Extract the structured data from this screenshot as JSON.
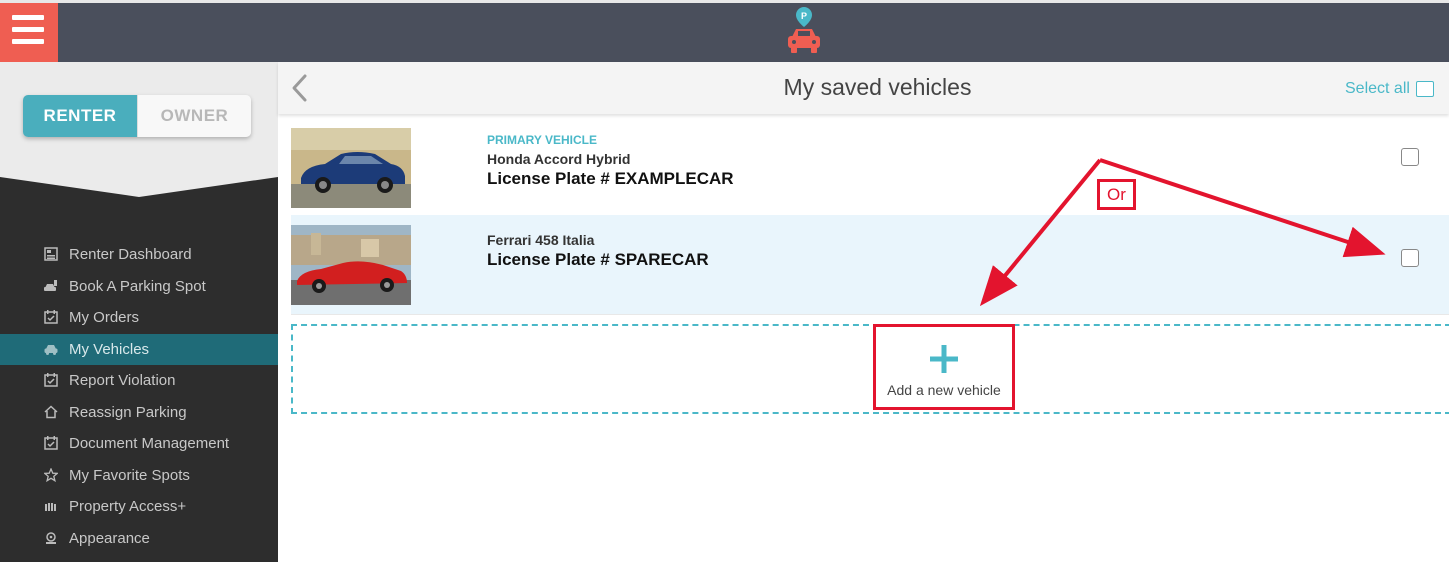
{
  "header": {
    "menu_icon": "hamburger-icon",
    "logo_icon": "parking-car-logo-icon"
  },
  "sidebar": {
    "toggle": {
      "renter": "RENTER",
      "owner": "OWNER",
      "selected": "RENTER"
    },
    "items": [
      {
        "label": "Renter Dashboard",
        "icon": "dashboard-icon"
      },
      {
        "label": "Book A Parking Spot",
        "icon": "car-book-icon"
      },
      {
        "label": "My Orders",
        "icon": "calendar-check-icon"
      },
      {
        "label": "My Vehicles",
        "icon": "car-icon",
        "active": true
      },
      {
        "label": "Report Violation",
        "icon": "calendar-check-icon"
      },
      {
        "label": "Reassign Parking",
        "icon": "home-icon"
      },
      {
        "label": "Document Management",
        "icon": "calendar-check-icon"
      },
      {
        "label": "My Favorite Spots",
        "icon": "star-icon"
      },
      {
        "label": "Property Access+",
        "icon": "gate-icon"
      },
      {
        "label": "Appearance",
        "icon": "palette-icon"
      }
    ]
  },
  "main": {
    "title": "My saved vehicles",
    "select_all_label": "Select all",
    "vehicles": [
      {
        "tag": "PRIMARY VEHICLE",
        "name": "Honda Accord Hybrid",
        "plate": "License Plate # EXAMPLECAR"
      },
      {
        "tag": "",
        "name": "Ferrari 458 Italia",
        "plate": "License Plate # SPARECAR"
      }
    ],
    "add_vehicle_label": "Add a new vehicle"
  },
  "annotation": {
    "or_label": "Or",
    "color": "#e3142e"
  },
  "colors": {
    "accent": "#4ab8c8",
    "header_bg": "#4a4f5c",
    "menu_button": "#ef5e52",
    "sidebar_bg": "#2d2d2d",
    "active_item": "#1f6b78"
  }
}
